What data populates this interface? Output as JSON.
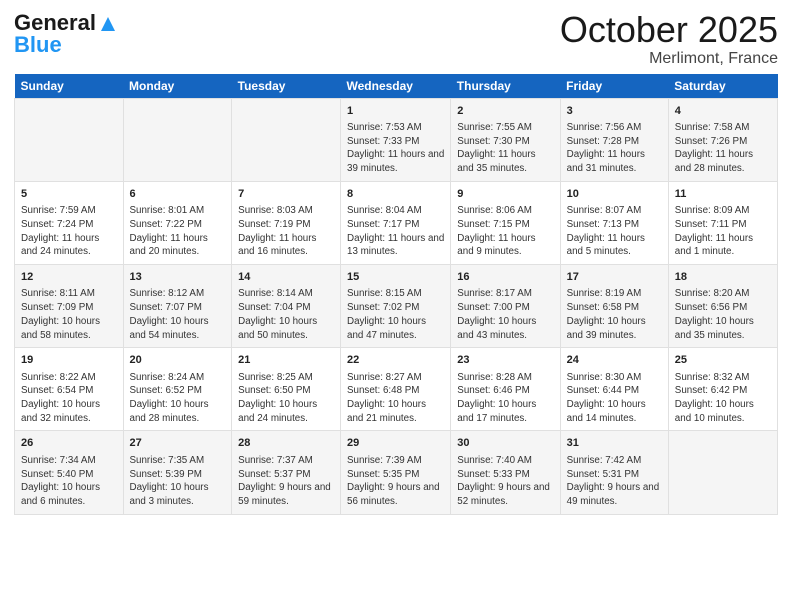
{
  "header": {
    "logo_general": "General",
    "logo_blue": "Blue",
    "title": "October 2025",
    "subtitle": "Merlimont, France"
  },
  "days_of_week": [
    "Sunday",
    "Monday",
    "Tuesday",
    "Wednesday",
    "Thursday",
    "Friday",
    "Saturday"
  ],
  "weeks": [
    [
      {
        "day": "",
        "info": ""
      },
      {
        "day": "",
        "info": ""
      },
      {
        "day": "",
        "info": ""
      },
      {
        "day": "1",
        "info": "Sunrise: 7:53 AM\nSunset: 7:33 PM\nDaylight: 11 hours and 39 minutes."
      },
      {
        "day": "2",
        "info": "Sunrise: 7:55 AM\nSunset: 7:30 PM\nDaylight: 11 hours and 35 minutes."
      },
      {
        "day": "3",
        "info": "Sunrise: 7:56 AM\nSunset: 7:28 PM\nDaylight: 11 hours and 31 minutes."
      },
      {
        "day": "4",
        "info": "Sunrise: 7:58 AM\nSunset: 7:26 PM\nDaylight: 11 hours and 28 minutes."
      }
    ],
    [
      {
        "day": "5",
        "info": "Sunrise: 7:59 AM\nSunset: 7:24 PM\nDaylight: 11 hours and 24 minutes."
      },
      {
        "day": "6",
        "info": "Sunrise: 8:01 AM\nSunset: 7:22 PM\nDaylight: 11 hours and 20 minutes."
      },
      {
        "day": "7",
        "info": "Sunrise: 8:03 AM\nSunset: 7:19 PM\nDaylight: 11 hours and 16 minutes."
      },
      {
        "day": "8",
        "info": "Sunrise: 8:04 AM\nSunset: 7:17 PM\nDaylight: 11 hours and 13 minutes."
      },
      {
        "day": "9",
        "info": "Sunrise: 8:06 AM\nSunset: 7:15 PM\nDaylight: 11 hours and 9 minutes."
      },
      {
        "day": "10",
        "info": "Sunrise: 8:07 AM\nSunset: 7:13 PM\nDaylight: 11 hours and 5 minutes."
      },
      {
        "day": "11",
        "info": "Sunrise: 8:09 AM\nSunset: 7:11 PM\nDaylight: 11 hours and 1 minute."
      }
    ],
    [
      {
        "day": "12",
        "info": "Sunrise: 8:11 AM\nSunset: 7:09 PM\nDaylight: 10 hours and 58 minutes."
      },
      {
        "day": "13",
        "info": "Sunrise: 8:12 AM\nSunset: 7:07 PM\nDaylight: 10 hours and 54 minutes."
      },
      {
        "day": "14",
        "info": "Sunrise: 8:14 AM\nSunset: 7:04 PM\nDaylight: 10 hours and 50 minutes."
      },
      {
        "day": "15",
        "info": "Sunrise: 8:15 AM\nSunset: 7:02 PM\nDaylight: 10 hours and 47 minutes."
      },
      {
        "day": "16",
        "info": "Sunrise: 8:17 AM\nSunset: 7:00 PM\nDaylight: 10 hours and 43 minutes."
      },
      {
        "day": "17",
        "info": "Sunrise: 8:19 AM\nSunset: 6:58 PM\nDaylight: 10 hours and 39 minutes."
      },
      {
        "day": "18",
        "info": "Sunrise: 8:20 AM\nSunset: 6:56 PM\nDaylight: 10 hours and 35 minutes."
      }
    ],
    [
      {
        "day": "19",
        "info": "Sunrise: 8:22 AM\nSunset: 6:54 PM\nDaylight: 10 hours and 32 minutes."
      },
      {
        "day": "20",
        "info": "Sunrise: 8:24 AM\nSunset: 6:52 PM\nDaylight: 10 hours and 28 minutes."
      },
      {
        "day": "21",
        "info": "Sunrise: 8:25 AM\nSunset: 6:50 PM\nDaylight: 10 hours and 24 minutes."
      },
      {
        "day": "22",
        "info": "Sunrise: 8:27 AM\nSunset: 6:48 PM\nDaylight: 10 hours and 21 minutes."
      },
      {
        "day": "23",
        "info": "Sunrise: 8:28 AM\nSunset: 6:46 PM\nDaylight: 10 hours and 17 minutes."
      },
      {
        "day": "24",
        "info": "Sunrise: 8:30 AM\nSunset: 6:44 PM\nDaylight: 10 hours and 14 minutes."
      },
      {
        "day": "25",
        "info": "Sunrise: 8:32 AM\nSunset: 6:42 PM\nDaylight: 10 hours and 10 minutes."
      }
    ],
    [
      {
        "day": "26",
        "info": "Sunrise: 7:34 AM\nSunset: 5:40 PM\nDaylight: 10 hours and 6 minutes."
      },
      {
        "day": "27",
        "info": "Sunrise: 7:35 AM\nSunset: 5:39 PM\nDaylight: 10 hours and 3 minutes."
      },
      {
        "day": "28",
        "info": "Sunrise: 7:37 AM\nSunset: 5:37 PM\nDaylight: 9 hours and 59 minutes."
      },
      {
        "day": "29",
        "info": "Sunrise: 7:39 AM\nSunset: 5:35 PM\nDaylight: 9 hours and 56 minutes."
      },
      {
        "day": "30",
        "info": "Sunrise: 7:40 AM\nSunset: 5:33 PM\nDaylight: 9 hours and 52 minutes."
      },
      {
        "day": "31",
        "info": "Sunrise: 7:42 AM\nSunset: 5:31 PM\nDaylight: 9 hours and 49 minutes."
      },
      {
        "day": "",
        "info": ""
      }
    ]
  ]
}
